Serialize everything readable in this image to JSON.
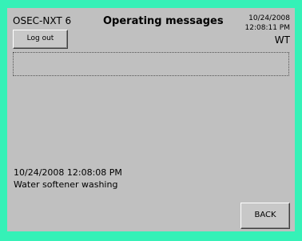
{
  "header": {
    "device_name": "OSEC-NXT 6",
    "title": "Operating messages",
    "date": "10/24/2008",
    "time": "12:08:11 PM",
    "user": "WT"
  },
  "buttons": {
    "logout_label": "Log out",
    "back_label": "BACK"
  },
  "messages": [
    {
      "timestamp": "10/24/2008 12:08:08 PM",
      "text": "Water softener washing"
    }
  ],
  "colors": {
    "frame": "#35f1b7",
    "screen_background": "#c0c0c0"
  }
}
